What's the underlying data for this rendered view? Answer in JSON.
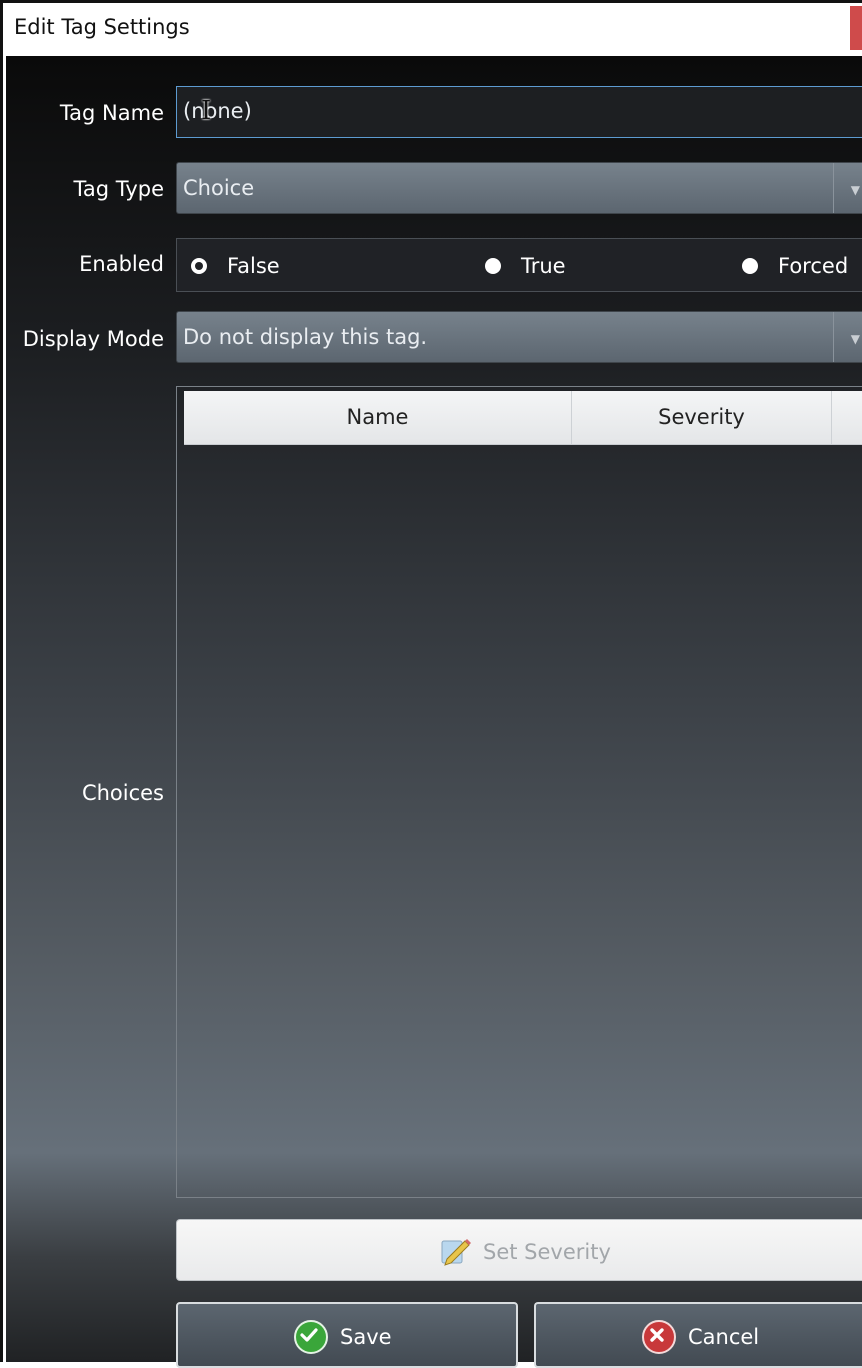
{
  "window": {
    "title": "Edit Tag Settings"
  },
  "fields": {
    "tag_name_label": "Tag Name",
    "tag_name_value": "(none)",
    "tag_type_label": "Tag Type",
    "tag_type_value": "Choice",
    "enabled_label": "Enabled",
    "enabled_options": [
      "False",
      "True",
      "Forced"
    ],
    "enabled_selected": "False",
    "display_mode_label": "Display Mode",
    "display_mode_value": "Do not display this tag.",
    "choices_label": "Choices"
  },
  "grid": {
    "columns": [
      "Name",
      "Severity"
    ],
    "rows": []
  },
  "buttons": {
    "set_severity": "Set Severity",
    "save": "Save",
    "cancel": "Cancel"
  },
  "icons": {
    "set_severity": "pencil-icon",
    "save": "checkmark-icon",
    "cancel": "cancel-x-icon",
    "combo_arrow": "chevron-down-icon",
    "text_cursor": "i-beam-cursor-icon"
  },
  "colors": {
    "focus_border": "#5d9bd1",
    "close_button": "#cf4b4b",
    "save_icon": "#3aa63a",
    "cancel_icon": "#c8383a"
  }
}
